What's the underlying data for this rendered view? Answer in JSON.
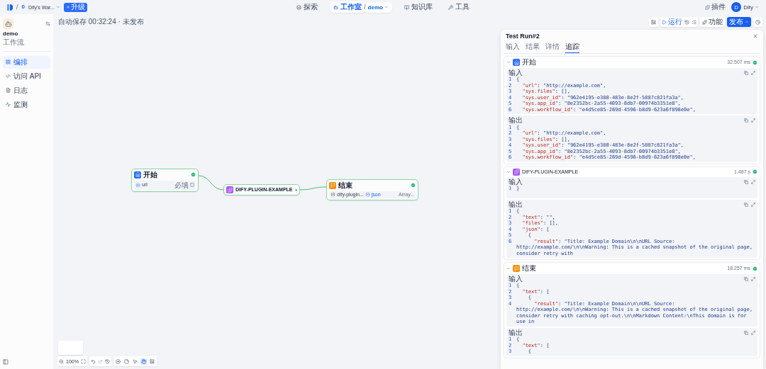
{
  "top_bar": {
    "separator": "/",
    "workspace_badge": "0",
    "workspace": "Dify's War...",
    "upgrade": "升级",
    "nav": [
      {
        "kind": "explore",
        "label": "探索",
        "selected": false
      },
      {
        "kind": "studio",
        "label": "工作室",
        "selected": true,
        "separator": "/",
        "app": "demo"
      },
      {
        "kind": "knowledge",
        "label": "知识库",
        "selected": false
      },
      {
        "kind": "tools",
        "label": "工具",
        "selected": false
      }
    ],
    "plugins": "插件",
    "avatar": "D",
    "user": "Dify"
  },
  "sidebar": {
    "app_name": "demo",
    "app_type": "工作流",
    "items": [
      {
        "kind": "orchestrate",
        "label": "编排",
        "selected": true
      },
      {
        "kind": "api",
        "label": "访问 API",
        "selected": false
      },
      {
        "kind": "logs",
        "label": "日志",
        "selected": false
      },
      {
        "kind": "monitor",
        "label": "监测",
        "selected": false
      }
    ]
  },
  "canvas": {
    "autosave": "自动保存 00:32:24 · 未发布",
    "run": "运行",
    "features": "功能",
    "publish": "发布",
    "nodes": [
      {
        "kind": "start",
        "title": "开始",
        "succeeded": true,
        "vars": [
          {
            "name": "url",
            "tag": "必填"
          }
        ]
      },
      {
        "kind": "plugin",
        "title": "DIFY-PLUGIN-EXAMPLE",
        "succeeded": true
      },
      {
        "kind": "end",
        "title": "结束",
        "succeeded": true,
        "vars": [
          {
            "source": "dify-plugin...",
            "name": "json",
            "tag": "Array..."
          }
        ]
      }
    ],
    "zoom": "100%",
    "tools": [
      {
        "kind": "add",
        "selected": false
      },
      {
        "kind": "note",
        "selected": false
      },
      {
        "kind": "pointer",
        "selected": false
      },
      {
        "kind": "hand",
        "selected": true
      },
      {
        "kind": "organize",
        "selected": false
      }
    ]
  },
  "run_panel": {
    "title": "Test Run#2",
    "tabs": [
      {
        "label": "输入",
        "selected": false
      },
      {
        "label": "结果",
        "selected": false
      },
      {
        "label": "详情",
        "selected": false
      },
      {
        "label": "追踪",
        "selected": true
      }
    ],
    "sections": [
      {
        "kind": "start",
        "title": "开始",
        "time": "32.507 ms",
        "succeeded": true,
        "blocks": [
          {
            "label": "输入",
            "lines": [
              {
                "n": "1",
                "value": "{"
              },
              {
                "n": "2",
                "key": "  \"url\"",
                "value": ": \"http://example.com\","
              },
              {
                "n": "3",
                "key": "  \"sys.files\"",
                "value": ": [],"
              },
              {
                "n": "4",
                "key": "  \"sys.user_id\"",
                "value": ": \"962e4195-e380-483e-8e2f-5887c821fa3a\","
              },
              {
                "n": "5",
                "key": "  \"sys.app_id\"",
                "value": ": \"8e2352bc-2a55-4093-8db7-00974b3351e8\","
              },
              {
                "n": "6",
                "key": "  \"sys.workflow_id\"",
                "value": ": \"e4d5ce85-269d-4596-b8d9-623a6f898e0e\","
              }
            ]
          },
          {
            "label": "输出",
            "lines": [
              {
                "n": "1",
                "value": "{"
              },
              {
                "n": "2",
                "key": "  \"url\"",
                "value": ": \"http://example.com\","
              },
              {
                "n": "3",
                "key": "  \"sys.files\"",
                "value": ": [],"
              },
              {
                "n": "4",
                "key": "  \"sys.user_id\"",
                "value": ": \"962e4195-e380-483e-8e2f-5887c821fa3a\","
              },
              {
                "n": "5",
                "key": "  \"sys.app_id\"",
                "value": ": \"8e2352bc-2a55-4093-8db7-00974b3351e8\","
              },
              {
                "n": "6",
                "key": "  \"sys.workflow_id\"",
                "value": ": \"e4d5ce85-269d-4596-b8d9-623a6f898e0e\","
              }
            ]
          }
        ]
      },
      {
        "kind": "plugin",
        "title": "DIFY-PLUGIN-EXAMPLE",
        "time": "1.487 s",
        "succeeded": true,
        "blocks": [
          {
            "label": "输入",
            "lines": [
              {
                "n": "1",
                "value": "}"
              }
            ]
          },
          {
            "label": "输出",
            "lines": [
              {
                "n": "1",
                "value": "{"
              },
              {
                "n": "2",
                "key": "  \"text\"",
                "value": ": \"\","
              },
              {
                "n": "3",
                "key": "  \"files\"",
                "value": ": [],"
              },
              {
                "n": "4",
                "key": "  \"json\"",
                "value": ": ["
              },
              {
                "n": "5",
                "value": "    {"
              },
              {
                "n": "6",
                "key": "      \"result\"",
                "value": ": \"Title: Example Domain\\n\\nURL Source: http://example.com/\\n\\nWarning: This is a cached snapshot of the original page, consider retry with"
              }
            ]
          }
        ]
      },
      {
        "kind": "end",
        "title": "结束",
        "time": "18.257 ms",
        "succeeded": true,
        "blocks": [
          {
            "label": "输入",
            "lines": [
              {
                "n": "1",
                "value": "{"
              },
              {
                "n": "2",
                "key": "  \"text\"",
                "value": ": ["
              },
              {
                "n": "3",
                "value": "    {"
              },
              {
                "n": "4",
                "key": "      \"result\"",
                "value": ": \"Title: Example Domain\\n\\nURL Source: http://example.com/\\n\\nWarning: This is a cached snapshot of the original page, consider retry with caching opt-out.\\n\\nMarkdown Content:\\nThis domain is for use in"
              }
            ]
          },
          {
            "label": "输出",
            "lines": [
              {
                "n": "1",
                "value": "{"
              },
              {
                "n": "2",
                "key": "  \"text\"",
                "value": ": ["
              },
              {
                "n": "3",
                "value": "    {"
              }
            ]
          }
        ]
      }
    ]
  }
}
